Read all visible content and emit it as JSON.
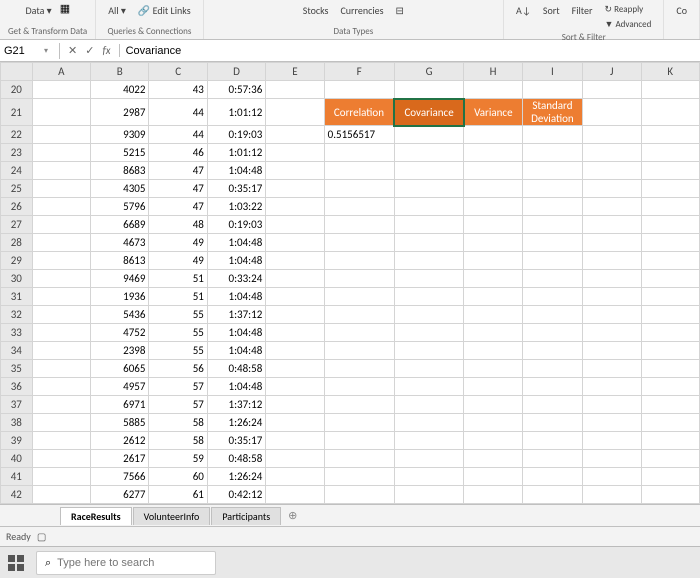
{
  "ribbon": {
    "data_menu": "Data",
    "refresh_all": "All",
    "edit_links": "Edit Links",
    "group1_label": "Get & Transform Data",
    "group2_label": "Queries & Connections",
    "stocks": "Stocks",
    "currencies": "Currencies",
    "data_types_label": "Data Types",
    "sort_az": "↓",
    "sort": "Sort",
    "filter": "Filter",
    "reapply": "Reapply",
    "advanced": "Advanced",
    "sort_filter_label": "Sort & Filter",
    "co": "Co"
  },
  "name_box": "G21",
  "formula": "Covariance",
  "columns": [
    "A",
    "B",
    "C",
    "D",
    "E",
    "F",
    "G",
    "H",
    "I",
    "J",
    "K"
  ],
  "rows": [
    {
      "n": 20,
      "B": 4022,
      "C": 43,
      "D": "0:57:36"
    },
    {
      "n": 21,
      "B": 2987,
      "C": 44,
      "D": "1:01:12",
      "hl": {
        "F": "Correlation",
        "G": "Covariance",
        "H": "Variance",
        "I": "Standard Deviation"
      },
      "selHl": "G"
    },
    {
      "n": 22,
      "B": 9309,
      "C": 44,
      "D": "0:19:03",
      "F": "0.5156517"
    },
    {
      "n": 23,
      "B": 5215,
      "C": 46,
      "D": "1:01:12"
    },
    {
      "n": 24,
      "B": 8683,
      "C": 47,
      "D": "1:04:48"
    },
    {
      "n": 25,
      "B": 4305,
      "C": 47,
      "D": "0:35:17"
    },
    {
      "n": 26,
      "B": 5796,
      "C": 47,
      "D": "1:03:22"
    },
    {
      "n": 27,
      "B": 6689,
      "C": 48,
      "D": "0:19:03"
    },
    {
      "n": 28,
      "B": 4673,
      "C": 49,
      "D": "1:04:48"
    },
    {
      "n": 29,
      "B": 8613,
      "C": 49,
      "D": "1:04:48"
    },
    {
      "n": 30,
      "B": 9469,
      "C": 51,
      "D": "0:33:24"
    },
    {
      "n": 31,
      "B": 1936,
      "C": 51,
      "D": "1:04:48"
    },
    {
      "n": 32,
      "B": 5436,
      "C": 55,
      "D": "1:37:12"
    },
    {
      "n": 33,
      "B": 4752,
      "C": 55,
      "D": "1:04:48"
    },
    {
      "n": 34,
      "B": 2398,
      "C": 55,
      "D": "1:04:48"
    },
    {
      "n": 35,
      "B": 6065,
      "C": 56,
      "D": "0:48:58"
    },
    {
      "n": 36,
      "B": 4957,
      "C": 57,
      "D": "1:04:48"
    },
    {
      "n": 37,
      "B": 6971,
      "C": 57,
      "D": "1:37:12"
    },
    {
      "n": 38,
      "B": 5885,
      "C": 58,
      "D": "1:26:24"
    },
    {
      "n": 39,
      "B": 2612,
      "C": 58,
      "D": "0:35:17"
    },
    {
      "n": 40,
      "B": 2617,
      "C": 59,
      "D": "0:48:58"
    },
    {
      "n": 41,
      "B": 7566,
      "C": 60,
      "D": "1:26:24"
    },
    {
      "n": 42,
      "B": 6277,
      "C": 61,
      "D": "0:42:12"
    }
  ],
  "tabs": [
    "RaceResults",
    "VolunteerInfo",
    "Participants"
  ],
  "active_tab": 0,
  "status": "Ready",
  "search_placeholder": "Type here to search"
}
